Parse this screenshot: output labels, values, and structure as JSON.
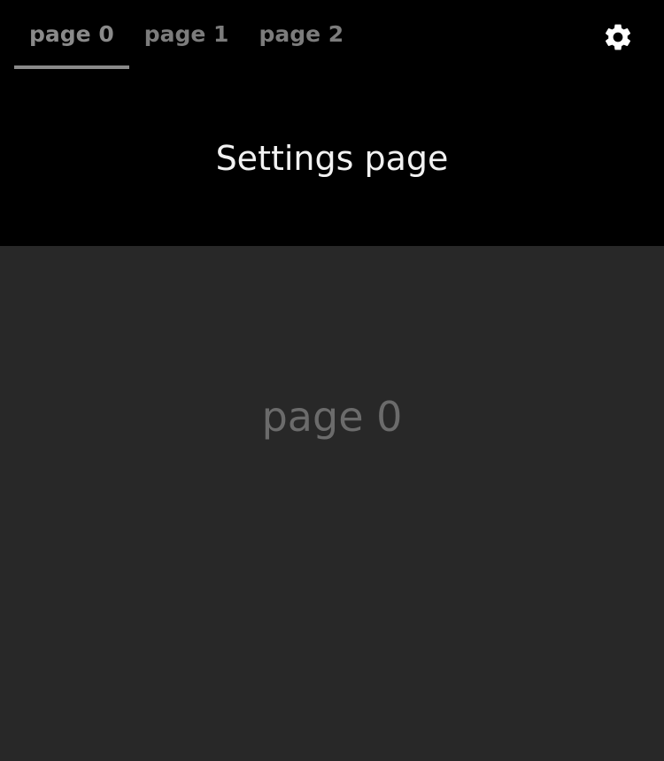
{
  "tabs": [
    {
      "label": "page 0",
      "active": true
    },
    {
      "label": "page 1",
      "active": false
    },
    {
      "label": "page 2",
      "active": false
    }
  ],
  "header": {
    "title": "Settings page",
    "settings_icon": "gear-icon"
  },
  "main": {
    "current_page_label": "page 0"
  },
  "colors": {
    "header_background": "#000000",
    "content_background": "#282828",
    "title_text": "#f2f2f2",
    "active_tab": "#8a8a8a",
    "inactive_tab": "#7c7c7c",
    "content_text": "#6b6b6b",
    "icon": "#ffffff"
  }
}
